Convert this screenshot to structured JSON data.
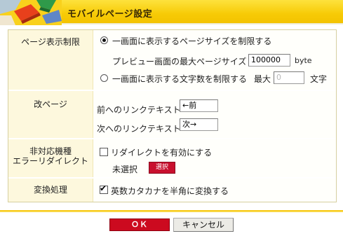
{
  "header": {
    "title": "モバイルページ設定"
  },
  "page_limit": {
    "label": "ページ表示制限",
    "option_size_label": "一画面に表示するページサイズを制限する",
    "option_size_selected": true,
    "preview_label": "プレビュー画面の最大ページサイズ",
    "preview_value": "100000",
    "preview_unit": "byte",
    "option_chars_label": "一画面に表示する文字数を制限する",
    "option_chars_selected": false,
    "max_label": "最大",
    "max_value": "0",
    "max_unit": "文字"
  },
  "page_break": {
    "label": "改ページ",
    "prev_label": "前へのリンクテキスト",
    "prev_value": "←前",
    "next_label": "次へのリンクテキスト",
    "next_value": "次→"
  },
  "unsupported": {
    "label_line1": "非対応機種",
    "label_line2": "エラーリダイレクト",
    "redirect_label": "リダイレクトを有効にする",
    "redirect_checked": false,
    "unselected_text": "未選択",
    "select_button": "選択"
  },
  "conversion": {
    "label": "変換処理",
    "option_label": "英数カタカナを半角に変換する",
    "option_checked": true
  },
  "footer": {
    "ok_label": "ＯＫ",
    "cancel_label": "キャンセル"
  },
  "colors": {
    "header_yellow": "#f7cb06",
    "label_bg": "#fdf8dd",
    "ok_red": "#cc0a1f",
    "select_red": "#c8102e"
  }
}
